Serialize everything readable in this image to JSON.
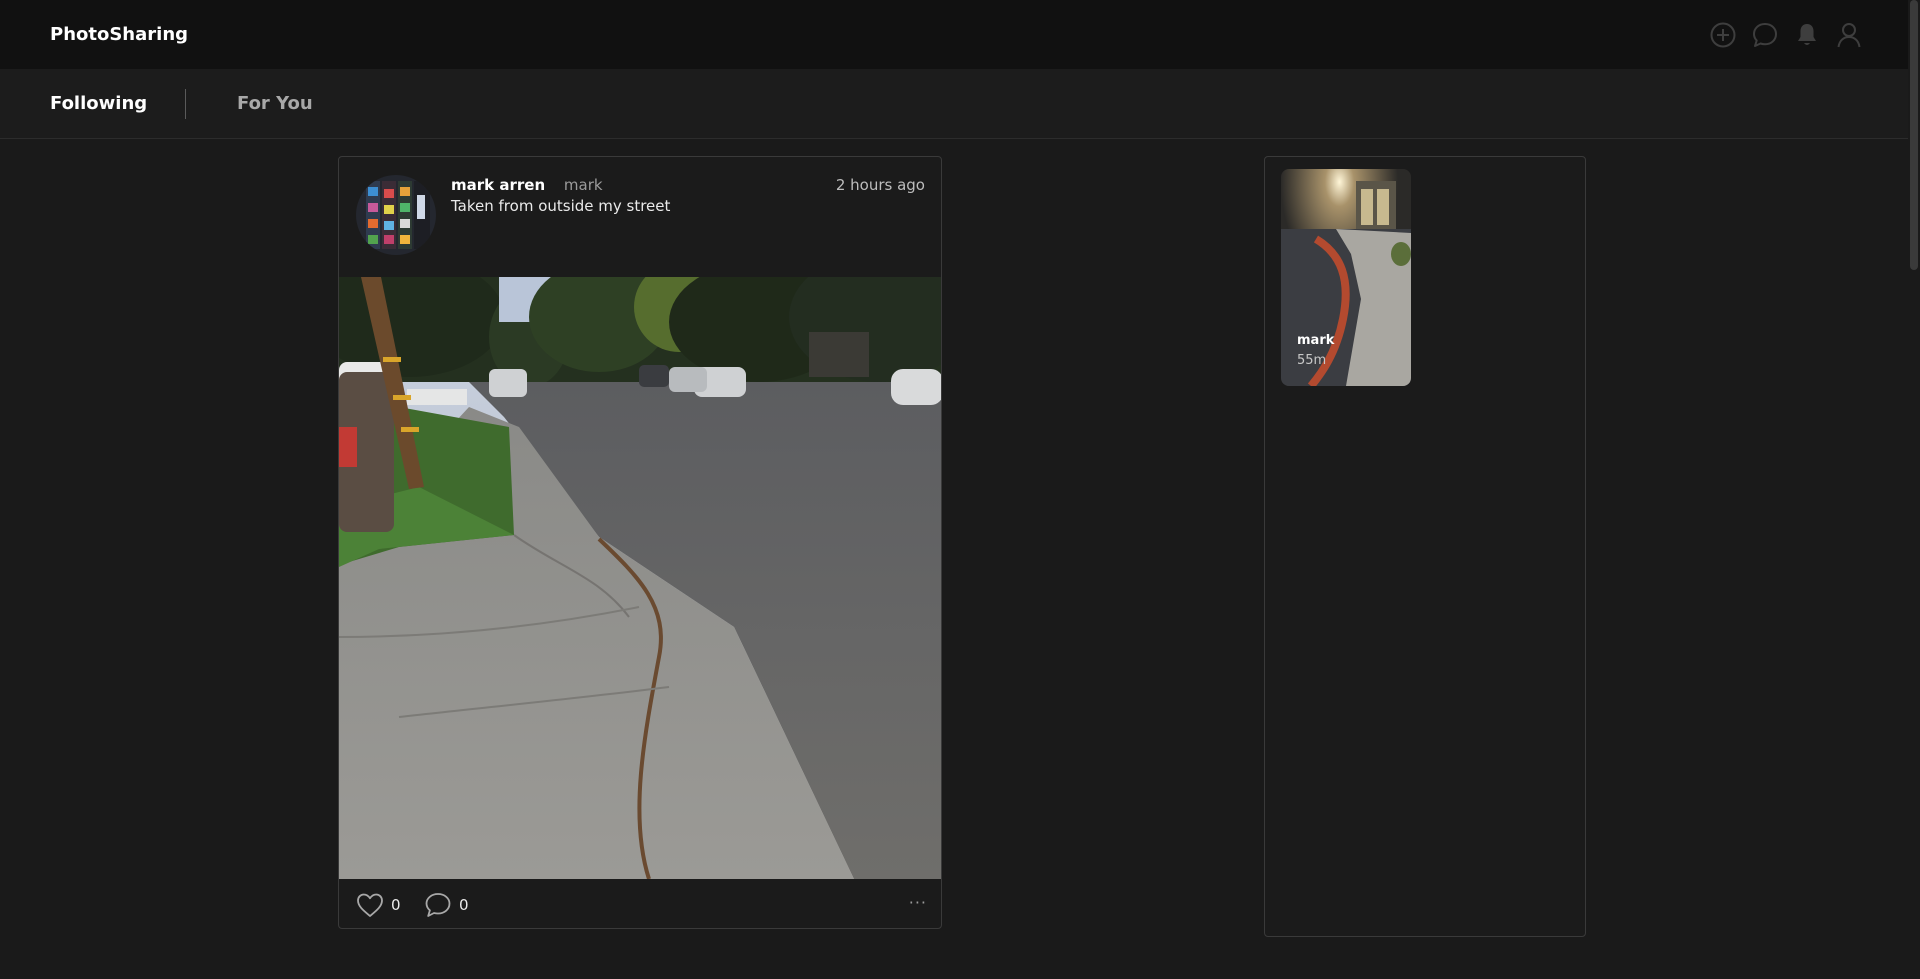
{
  "app": {
    "brand": "PhotoSharing"
  },
  "header_icons": [
    "plus-circle-icon",
    "chat-icon",
    "bell-icon",
    "user-icon"
  ],
  "tabs": [
    {
      "label": "Following",
      "active": true
    },
    {
      "label": "For You",
      "active": false
    }
  ],
  "post": {
    "author_name": "mark arren",
    "author_handle": "mark",
    "time": "2 hours ago",
    "caption": "Taken from outside my street",
    "likes": "0",
    "comments": "0",
    "more": "···"
  },
  "stories": [
    {
      "user": "mark",
      "time": "55m"
    }
  ],
  "colors": {
    "background": "#1a1a1a",
    "topbar": "#111111",
    "border": "#3a3a3a",
    "muted": "#9b9b9b"
  }
}
